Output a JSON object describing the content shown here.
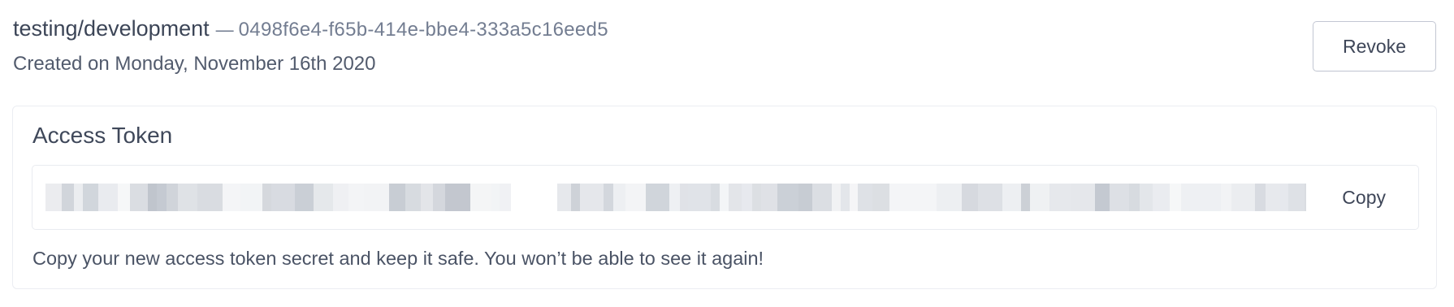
{
  "token": {
    "name": "testing/development",
    "separator": "—",
    "id": "0498f6e4-f65b-414e-bbe4-333a5c16eed5",
    "created": "Created on Monday, November 16th 2020"
  },
  "actions": {
    "revoke_label": "Revoke"
  },
  "access_token": {
    "title": "Access Token",
    "copy_label": "Copy",
    "help_text": "Copy your new access token secret and keep it safe. You won’t be able to see it again!"
  }
}
